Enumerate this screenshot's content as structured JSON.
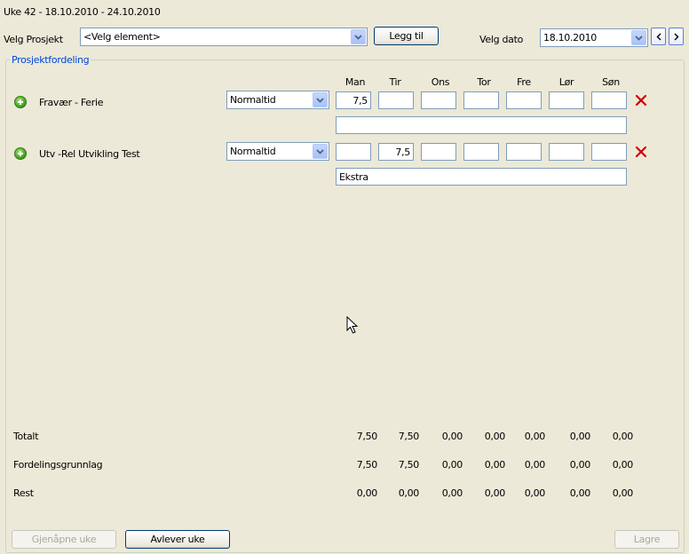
{
  "header": {
    "week_title": "Uke 42 - 18.10.2010 - 24.10.2010"
  },
  "project_select": {
    "label": "Velg Prosjekt",
    "value": "<Velg element>"
  },
  "add_button": "Legg til",
  "date_select": {
    "label": "Velg dato",
    "value": "18.10.2010"
  },
  "group_title": "Prosjektfordeling",
  "days": [
    "Man",
    "Tir",
    "Ons",
    "Tor",
    "Fre",
    "Lør",
    "Søn"
  ],
  "rows": [
    {
      "name": "Fravær - Ferie",
      "type": "Normaltid",
      "hours": [
        "7,5",
        "",
        "",
        "",
        "",
        "",
        ""
      ],
      "note": ""
    },
    {
      "name": "Utv -Rel Utvikling  Test",
      "type": "Normaltid",
      "hours": [
        "",
        "7,5",
        "",
        "",
        "",
        "",
        ""
      ],
      "note": "Ekstra"
    }
  ],
  "summary": [
    {
      "label": "Totalt",
      "values": [
        "7,50",
        "7,50",
        "0,00",
        "0,00",
        "0,00",
        "0,00",
        "0,00"
      ]
    },
    {
      "label": "Fordelingsgrunnlag",
      "values": [
        "7,50",
        "7,50",
        "0,00",
        "0,00",
        "0,00",
        "0,00",
        "0,00"
      ]
    },
    {
      "label": "Rest",
      "values": [
        "0,00",
        "0,00",
        "0,00",
        "0,00",
        "0,00",
        "0,00",
        "0,00"
      ]
    }
  ],
  "footer": {
    "reopen_label": "Gjenåpne uke",
    "deliver_label": "Avlever uke",
    "save_label": "Lagre"
  },
  "icons": {
    "add_row": "plus-circle-icon",
    "delete_row": "red-x-icon",
    "dropdown": "chevron-down-icon",
    "prev": "chevron-left-icon",
    "next": "chevron-right-icon",
    "cursor": "mouse-pointer-icon"
  },
  "colors": {
    "background": "#ece9d8",
    "group_title": "#0046d5",
    "delete": "#cc0000",
    "add": "#3d9a1c"
  }
}
